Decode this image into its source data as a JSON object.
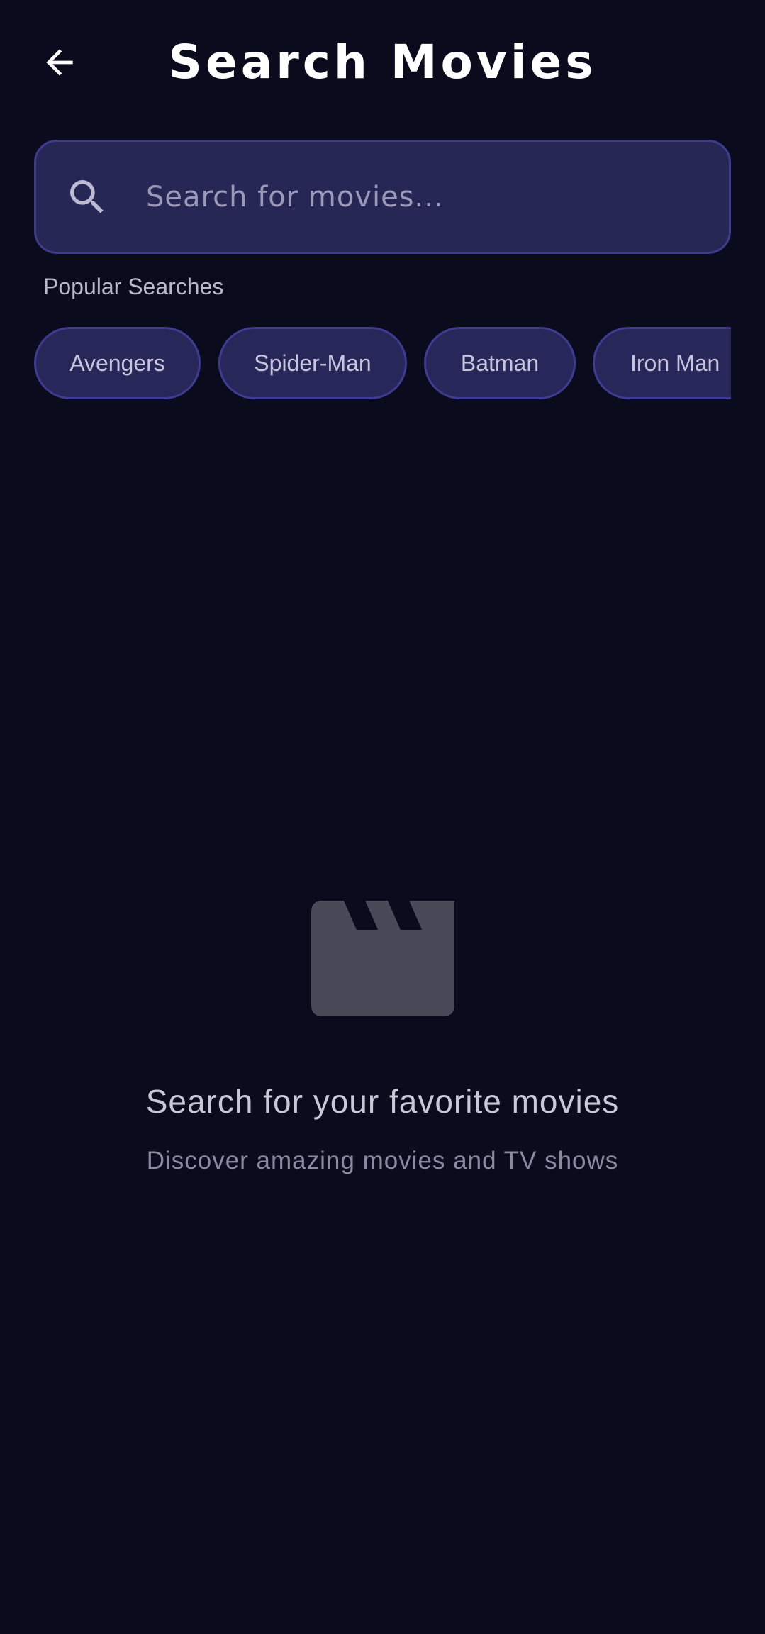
{
  "header": {
    "title": "Search Movies",
    "back_icon": "arrow-left-icon"
  },
  "search": {
    "placeholder": "Search for movies...",
    "value": "",
    "icon": "search-icon"
  },
  "popular": {
    "label": "Popular Searches",
    "chips": [
      "Avengers",
      "Spider-Man",
      "Batman",
      "Iron Man"
    ]
  },
  "empty_state": {
    "icon": "clapperboard-icon",
    "title": "Search for your favorite movies",
    "subtitle": "Discover amazing movies and TV shows"
  },
  "colors": {
    "background": "#0b0b1e",
    "search_box_fill": "#272755",
    "search_box_border": "#3e3a8c",
    "chip_fill": "#28275a",
    "chip_border": "#3f3b93",
    "icon_gray": "#4a4958"
  }
}
